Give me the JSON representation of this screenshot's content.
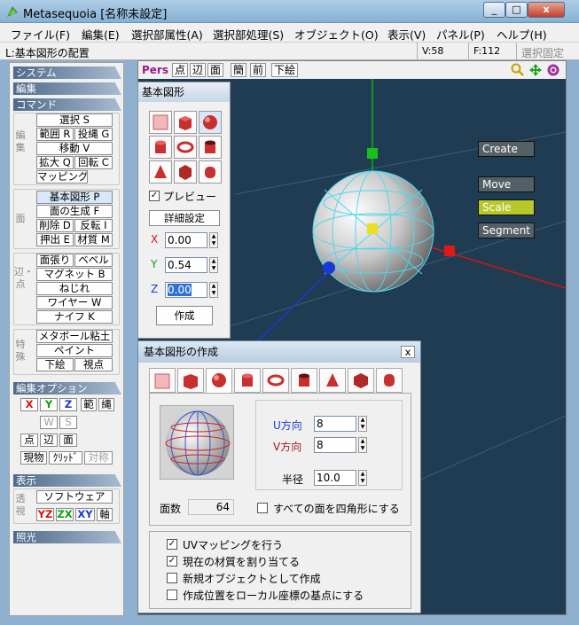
{
  "window": {
    "title": "Metasequoia [名称未設定]",
    "min": "_",
    "max": "□",
    "close": "x"
  },
  "menu": [
    "ファイル(F)",
    "編集(E)",
    "選択部属性(A)",
    "選択部処理(S)",
    "オブジェクト(O)",
    "表示(V)",
    "パネル(P)",
    "ヘルプ(H)"
  ],
  "info": {
    "mode": "L:基本図形の配置",
    "vertices": "V:58",
    "faces": "F:112",
    "lock": "選択固定"
  },
  "left": {
    "system": "システム",
    "edit": "編集",
    "command": "コマンド",
    "edit_group_label": "編集",
    "select": "選択 S",
    "range": "範囲 R",
    "lasso": "投縄 G",
    "move": "移動 V",
    "scale": "拡大 Q",
    "rotate": "回転 C",
    "mapping": "マッピング",
    "face_group_label": "面",
    "primitive": "基本図形 P",
    "face_create": "面の生成 F",
    "delete": "削除 D",
    "invert": "反転 I",
    "extrude": "押出 E",
    "material": "材質 M",
    "edge_group_label": "辺・点",
    "face_stretch": "面張り",
    "bevel": "ベベル",
    "magnet": "マグネット B",
    "twist": "ねじれ",
    "wire": "ワイヤー W",
    "knife": "ナイフ K",
    "special_group_label": "特殊",
    "metaball": "メタボール粘土",
    "paint": "ペイント",
    "underlay": "下絵",
    "viewpoint": "視点",
    "edit_option": "編集オプション",
    "x": "X",
    "y": "Y",
    "z": "Z",
    "sym_range": "範",
    "sym_lasso": "縄",
    "w": "W",
    "s": "S",
    "point": "点",
    "edge": "辺",
    "face": "面",
    "current": "現物",
    "grid": "ｸﾘｯﾄﾞ",
    "symmetric": "対称",
    "display": "表示",
    "display_group_label": "透視",
    "software": "ソフトウェア",
    "yz": "YZ",
    "zx": "ZX",
    "xy": "XY",
    "axis": "軸",
    "lighting": "照光"
  },
  "view": {
    "pers": "Pers",
    "point": "点",
    "edge": "辺",
    "face": "面",
    "simple": "簡",
    "front": "前",
    "underlay": "下絵",
    "mode_buttons": [
      "Create",
      "Move",
      "Scale",
      "Segment"
    ],
    "active_mode": "Scale"
  },
  "prim_panel": {
    "title": "基本図形",
    "preview": "プレビュー",
    "detail": "詳細設定",
    "x_label": "X",
    "y_label": "Y",
    "z_label": "Z",
    "x": "0.00",
    "y": "0.54",
    "z": "0.00",
    "create": "作成"
  },
  "dialog": {
    "title": "基本図形の作成",
    "close": "x",
    "u_label": "U方向",
    "v_label": "V方向",
    "radius_label": "半径",
    "u": "8",
    "v": "8",
    "radius": "10.0",
    "faces_label": "面数",
    "faces": "64",
    "all_quad": "すべての面を四角形にする",
    "opt_uv": "UVマッピングを行う",
    "opt_mat": "現在の材質を割り当てる",
    "opt_new": "新規オブジェクトとして作成",
    "opt_local": "作成位置をローカル座標の基点にする"
  },
  "colors": {
    "accent_active": "#b8c82a",
    "x_axis": "#e01010",
    "y_axis": "#10b010",
    "z_axis": "#1a3cc8",
    "scene_bg": "#1f3c52",
    "wire": "#4fd8ec"
  }
}
